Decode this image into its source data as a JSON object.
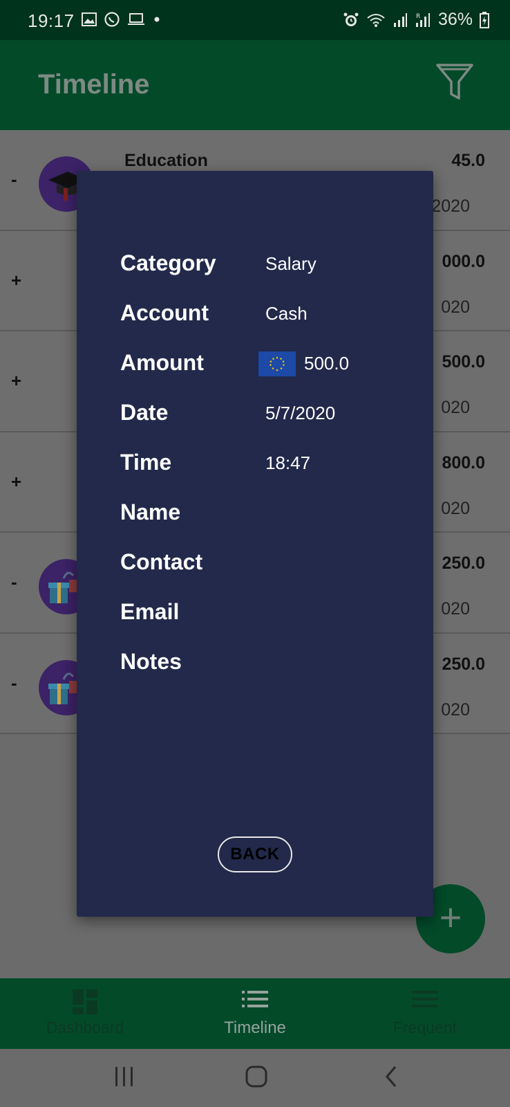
{
  "status_bar": {
    "time": "19:17",
    "battery": "36%"
  },
  "app_bar": {
    "title": "Timeline"
  },
  "list": {
    "rows": [
      {
        "sign": "-",
        "category": "Education",
        "amount": "45.0",
        "date_tail": "2020",
        "icon": "graduation-cap"
      },
      {
        "sign": "+",
        "category": "",
        "amount": "000.0",
        "date_tail": "020",
        "icon": ""
      },
      {
        "sign": "+",
        "category": "",
        "amount": "500.0",
        "date_tail": "020",
        "icon": ""
      },
      {
        "sign": "+",
        "category": "",
        "amount": "800.0",
        "date_tail": "020",
        "icon": ""
      },
      {
        "sign": "-",
        "category": "",
        "amount": "250.0",
        "date_tail": "020",
        "icon": "gift"
      },
      {
        "sign": "-",
        "category": "",
        "amount": "250.0",
        "date_tail": "020",
        "icon": "gift"
      }
    ]
  },
  "dialog": {
    "category_label": "Category",
    "category_value": "Salary",
    "account_label": "Account",
    "account_value": "Cash",
    "amount_label": "Amount",
    "amount_value": "500.0",
    "date_label": "Date",
    "date_value": "5/7/2020",
    "time_label": "Time",
    "time_value": "18:47",
    "name_label": "Name",
    "contact_label": "Contact",
    "email_label": "Email",
    "notes_label": "Notes",
    "back_label": "BACK"
  },
  "fab": {
    "label": "+"
  },
  "bottom_nav": {
    "dashboard": "Dashboard",
    "timeline": "Timeline",
    "frequent": "Frequent"
  },
  "colors": {
    "status_bar": "#00331b",
    "app_bar": "#034a29",
    "dialog_bg": "#22294a",
    "scrim": "#6b6b6b"
  }
}
